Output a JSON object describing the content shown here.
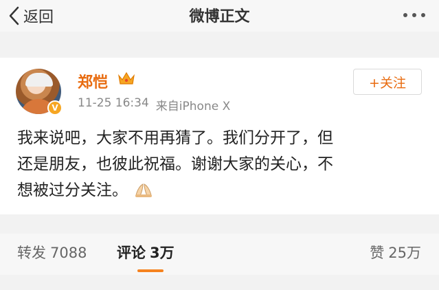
{
  "nav": {
    "back_label": "返回",
    "title": "微博正文"
  },
  "post": {
    "username": "郑恺",
    "date": "11-25 16:34",
    "source": "来自iPhone X",
    "follow_label": "+关注",
    "text_lines": [
      "我来说吧，大家不用再猜了。我们分开了，但",
      "还是朋友，也彼此祝福。谢谢大家的关心，不",
      "想被过分关注。"
    ]
  },
  "stats": {
    "repost_label": "转发",
    "repost_count": "7088",
    "comment_label": "评论",
    "comment_count": "3万",
    "like_label": "赞",
    "like_count": "25万"
  },
  "colors": {
    "accent": "#e86b0f",
    "underline": "#f5821f",
    "verified_badge": "#f6a623"
  },
  "icons": [
    "chevron-left-icon",
    "more-dots-icon",
    "crown-icon",
    "verified-badge-icon",
    "praying-hands-emoji"
  ]
}
